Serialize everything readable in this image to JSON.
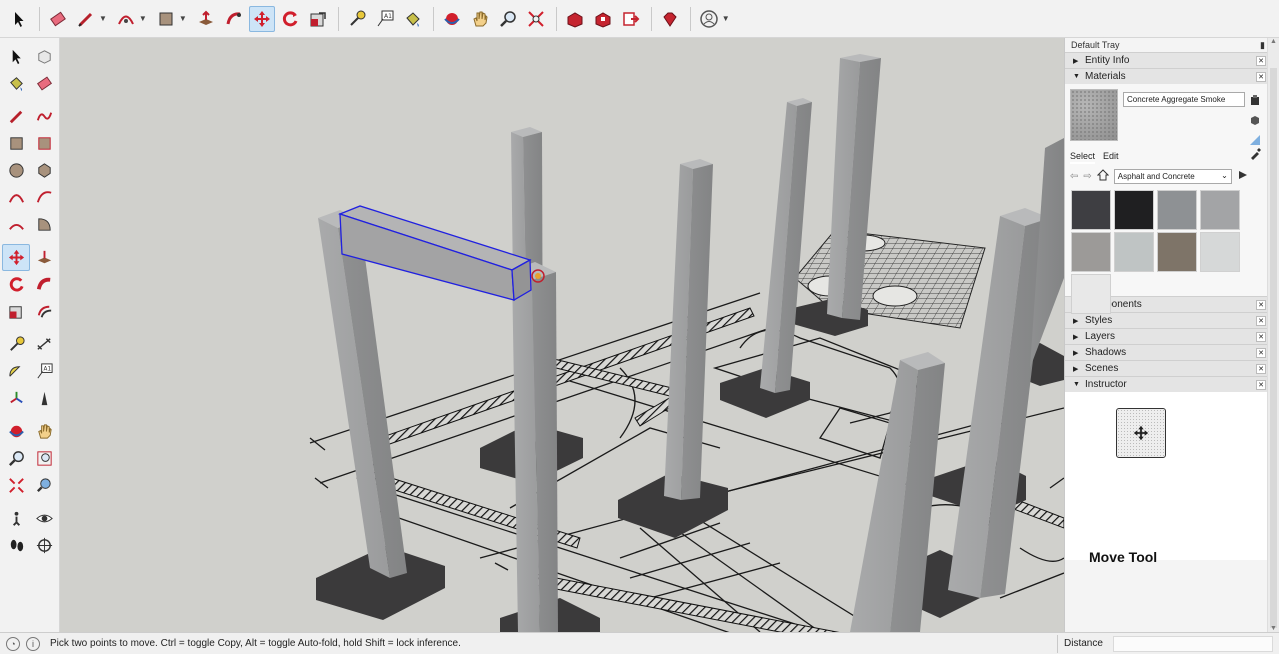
{
  "top_toolbar": {
    "tools": [
      "select",
      "eraser",
      "line",
      "arc",
      "rectangle",
      "push-pull",
      "follow-me",
      "move",
      "rotate",
      "scale",
      "tape-measure",
      "text",
      "paint-bucket",
      "orbit",
      "pan",
      "zoom",
      "zoom-extents",
      "warehouse",
      "extension-warehouse",
      "layout",
      "ruby",
      "account"
    ],
    "active_tool": "move"
  },
  "tray": {
    "title": "Default Tray",
    "panels": {
      "entity_info": "Entity Info",
      "materials": "Materials",
      "components": "Components",
      "styles": "Styles",
      "layers": "Layers",
      "shadows": "Shadows",
      "scenes": "Scenes",
      "instructor": "Instructor"
    },
    "materials": {
      "current_name": "Concrete Aggregate Smoke",
      "tab_select": "Select",
      "tab_edit": "Edit",
      "library": "Asphalt and Concrete",
      "swatch_colors": [
        "#3e3e42",
        "#1f1f21",
        "#8e9194",
        "#a3a4a6",
        "#9c9a98",
        "#bfc4c4",
        "#7e7468",
        "#d6d8d8",
        "#e8e8e8"
      ]
    },
    "instructor": {
      "tool_title": "Move Tool"
    }
  },
  "status": {
    "message": "Pick two points to move.  Ctrl = toggle Copy, Alt = toggle Auto-fold, hold Shift = lock inference.",
    "measurement_label": "Distance",
    "measurement_value": ""
  }
}
